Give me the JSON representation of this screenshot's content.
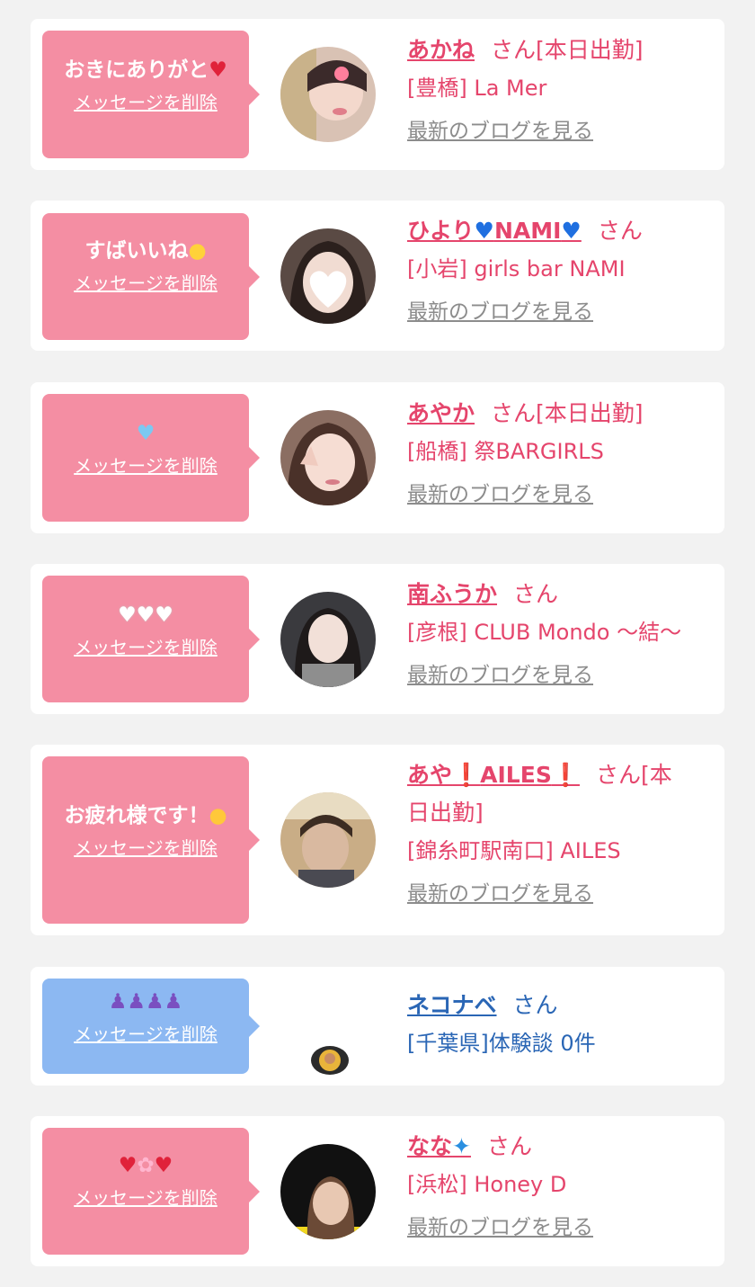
{
  "delete_label": "メッセージを削除",
  "blog_label": "最新のブログを見る",
  "san_label": "さん",
  "colors": {
    "bubble_pink": "#f48ea3",
    "bubble_blue": "#8cb8f2",
    "name_pink": "#e5456c",
    "name_blue": "#2a66b5",
    "link_gray": "#8c8c8c",
    "page_bg": "#f2f2f2"
  },
  "items": [
    {
      "message": "おきにありがと",
      "message_icon": "red-heart-emoji",
      "name": "あかね",
      "status": "[本日出勤]",
      "shop": "[豊橋] La Mer",
      "has_blog": true
    },
    {
      "message": "すばいいね",
      "message_icon": "baby-chick-emoji",
      "name": "ひより",
      "name_suffix": "NAMI",
      "name_icons": [
        "blue-heart-emoji"
      ],
      "status": "",
      "shop": "[小岩] girls bar NAMI",
      "has_blog": true
    },
    {
      "message": "",
      "message_icon": "light-blue-heart-emoji",
      "name": "あやか",
      "status": "[本日出勤]",
      "shop": "[船橋] 祭BARGIRLS",
      "has_blog": true
    },
    {
      "message": "",
      "message_icon": "white-heart-emoji-x3",
      "name": "南ふうか",
      "status": "",
      "shop": "[彦根] CLUB Mondo ～結～",
      "has_blog": true
    },
    {
      "message": "お疲れ様です！",
      "message_icon": "saluting-face-emoji",
      "name": "あや",
      "name_suffix": "AILES",
      "name_icons": [
        "exclamation-emoji"
      ],
      "status_part1": "[本",
      "status_part2": "日出勤]",
      "shop": "[錦糸町駅南口] AILES",
      "has_blog": true
    },
    {
      "message": "",
      "message_icon": "dancers-emoji",
      "name": "ネコナベ",
      "status": "",
      "shop": "[千葉県]体験談 0件",
      "has_blog": false
    },
    {
      "message": "",
      "message_icon": "heart-flower-heart-emoji",
      "name": "なな",
      "name_icons": [
        "butterfly-emoji"
      ],
      "status": "",
      "shop": "[浜松] Honey D",
      "has_blog": true
    }
  ]
}
